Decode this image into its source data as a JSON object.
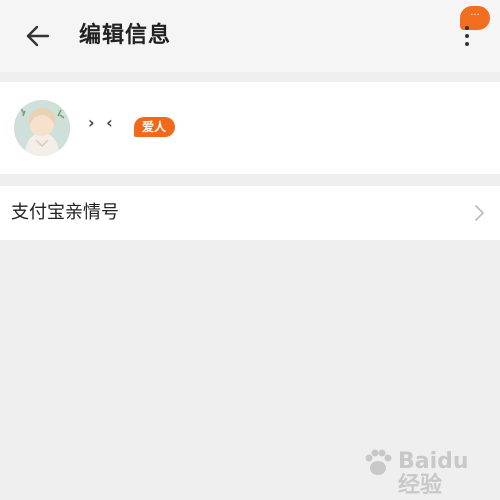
{
  "header": {
    "title": "编辑信息",
    "back_icon": "arrow-left-icon",
    "menu_icon": "more-vertical-icon",
    "menu_badge": "···",
    "badge_color": "#f36d1f"
  },
  "profile": {
    "avatar": "avatar-illustration",
    "nickname": "› ‹",
    "tag": "爱人",
    "tag_color": "#f2691c"
  },
  "alipay": {
    "label": "支付宝亲情号",
    "chevron_icon": "chevron-right-icon"
  },
  "watermark": {
    "text": "Baidu 经验"
  }
}
